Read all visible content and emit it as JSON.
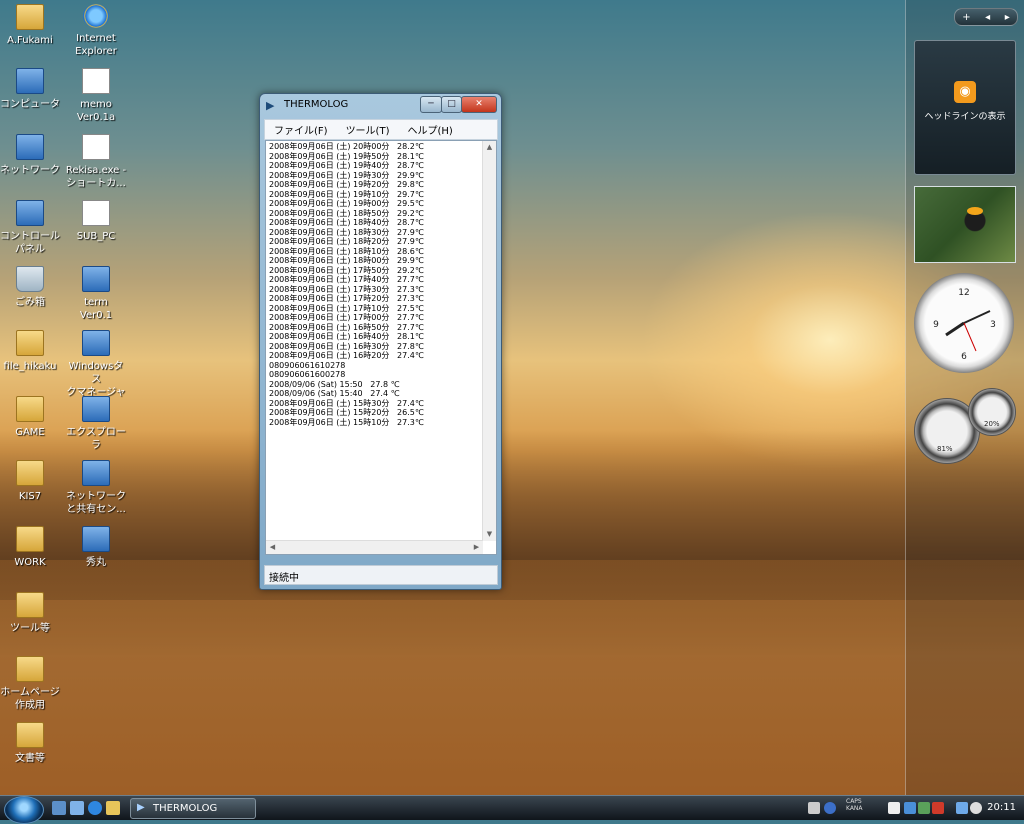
{
  "desktop": {
    "icons_left": [
      {
        "label": "A.Fukami",
        "icon": "user-folder-icon"
      },
      {
        "label": "コンピュータ",
        "icon": "computer-icon"
      },
      {
        "label": "ネットワーク",
        "icon": "network-icon"
      },
      {
        "label": "コントロール\nパネル",
        "icon": "control-panel-icon"
      },
      {
        "label": "ごみ箱",
        "icon": "recycle-bin-icon"
      },
      {
        "label": "file_hikaku",
        "icon": "folder-icon"
      },
      {
        "label": "GAME",
        "icon": "folder-icon"
      },
      {
        "label": "KIS7",
        "icon": "folder-icon"
      },
      {
        "label": "WORK",
        "icon": "folder-icon"
      },
      {
        "label": "ツール等",
        "icon": "folder-icon"
      },
      {
        "label": "ホームページ\n作成用",
        "icon": "folder-icon"
      },
      {
        "label": "文書等",
        "icon": "folder-icon"
      }
    ],
    "icons_right": [
      {
        "label": "Internet\nExplorer",
        "icon": "internet-explorer-icon"
      },
      {
        "label": "memo\nVer0.1a",
        "icon": "document-icon"
      },
      {
        "label": "Rekisa.exe -\nショートカ...",
        "icon": "shortcut-icon"
      },
      {
        "label": "SUB_PC",
        "icon": "shortcut-icon"
      },
      {
        "label": "term\nVer0.1",
        "icon": "app-icon"
      },
      {
        "label": "Windowsタス\nクマネージャ",
        "icon": "task-manager-icon"
      },
      {
        "label": "エクスプロー\nラ",
        "icon": "explorer-icon"
      },
      {
        "label": "ネットワーク\nと共有セン...",
        "icon": "network-center-icon"
      },
      {
        "label": "秀丸",
        "icon": "hidemaru-icon"
      }
    ]
  },
  "sidebar": {
    "feed_label": "ヘッドラインの表示",
    "meter_cpu": "81%",
    "meter_mem": "20%"
  },
  "window": {
    "title": "THERMOLOG",
    "menu": [
      "ファイル(F)",
      "ツール(T)",
      "ヘルプ(H)"
    ],
    "log_lines": [
      "2008年09月06日 (土) 20時00分   28.2℃",
      "2008年09月06日 (土) 19時50分   28.1℃",
      "2008年09月06日 (土) 19時40分   28.7℃",
      "2008年09月06日 (土) 19時30分   29.9℃",
      "2008年09月06日 (土) 19時20分   29.8℃",
      "2008年09月06日 (土) 19時10分   29.7℃",
      "2008年09月06日 (土) 19時00分   29.5℃",
      "2008年09月06日 (土) 18時50分   29.2℃",
      "2008年09月06日 (土) 18時40分   28.7℃",
      "2008年09月06日 (土) 18時30分   27.9℃",
      "2008年09月06日 (土) 18時20分   27.9℃",
      "2008年09月06日 (土) 18時10分   28.6℃",
      "2008年09月06日 (土) 18時00分   29.9℃",
      "2008年09月06日 (土) 17時50分   29.2℃",
      "2008年09月06日 (土) 17時40分   27.7℃",
      "2008年09月06日 (土) 17時30分   27.3℃",
      "2008年09月06日 (土) 17時20分   27.3℃",
      "2008年09月06日 (土) 17時10分   27.5℃",
      "2008年09月06日 (土) 17時00分   27.7℃",
      "2008年09月06日 (土) 16時50分   27.7℃",
      "2008年09月06日 (土) 16時40分   28.1℃",
      "2008年09月06日 (土) 16時30分   27.8℃",
      "2008年09月06日 (土) 16時20分   27.4℃",
      "080906061610278",
      "080906061600278",
      "2008/09/06 (Sat) 15:50   27.8 ℃",
      "2008/09/06 (Sat) 15:40   27.4 ℃",
      "2008年09月06日 (土) 15時30分   27.4℃",
      "2008年09月06日 (土) 15時20分   26.5℃",
      "2008年09月06日 (土) 15時10分   27.3℃"
    ],
    "status": "接続中"
  },
  "taskbar": {
    "task_label": "THERMOLOG",
    "caps": "CAPS",
    "kana": "KANA",
    "time": "20:11"
  }
}
